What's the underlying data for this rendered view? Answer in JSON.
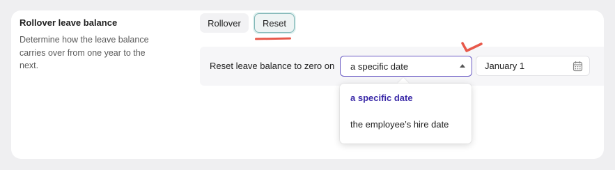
{
  "rollover_section": {
    "title": "Rollover leave balance",
    "description": "Determine how the leave balance carries over from one year to the next."
  },
  "mode_toggle": {
    "options": [
      "Rollover",
      "Reset"
    ],
    "selected": "Reset"
  },
  "reset_row": {
    "label": "Reset leave balance to zero on",
    "select_value": "a specific date",
    "date_value": "January 1"
  },
  "dropdown": {
    "options": [
      "a specific date",
      "the employee’s hire date"
    ],
    "selected": "a specific date"
  },
  "icons": {
    "select_caret": "caret-up-icon",
    "date_picker": "calendar-icon",
    "annotation": "checkmark-icon"
  },
  "colors": {
    "accent": "#3b2aa8",
    "select_border": "#6a5bc4",
    "reset_border": "#7fb5b5",
    "annotation_red": "#e8584a"
  }
}
